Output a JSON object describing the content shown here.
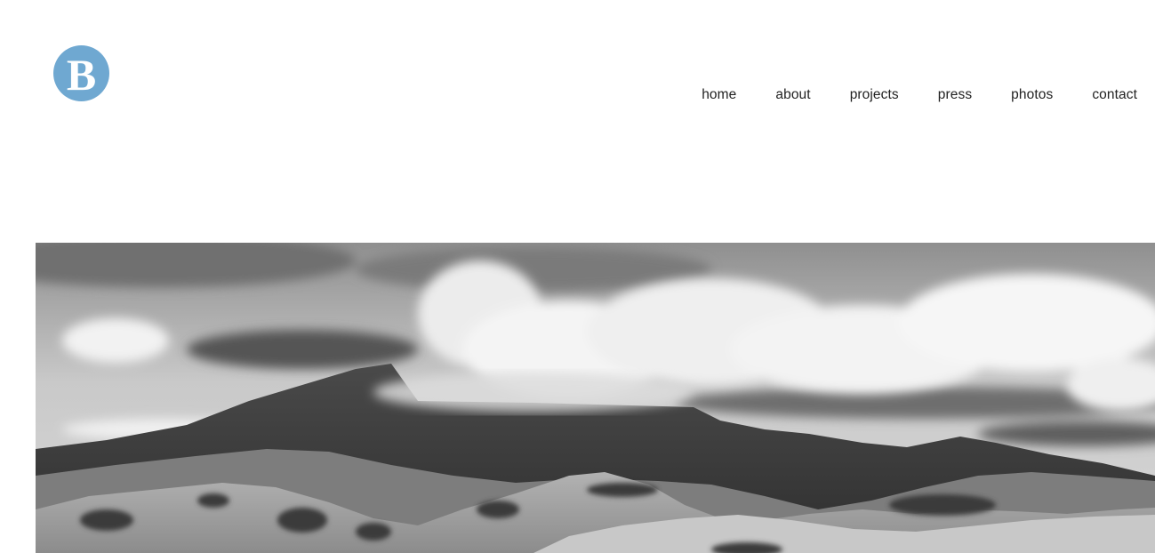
{
  "header": {
    "logo": {
      "letter": "B",
      "color": "#6fa8d1",
      "icon": "letter-b-logo"
    }
  },
  "nav": {
    "items": [
      {
        "label": "home"
      },
      {
        "label": "about"
      },
      {
        "label": "projects"
      },
      {
        "label": "press"
      },
      {
        "label": "photos"
      },
      {
        "label": "contact"
      }
    ]
  },
  "hero": {
    "image": "grayscale-mountain-landscape-with-clouds"
  }
}
